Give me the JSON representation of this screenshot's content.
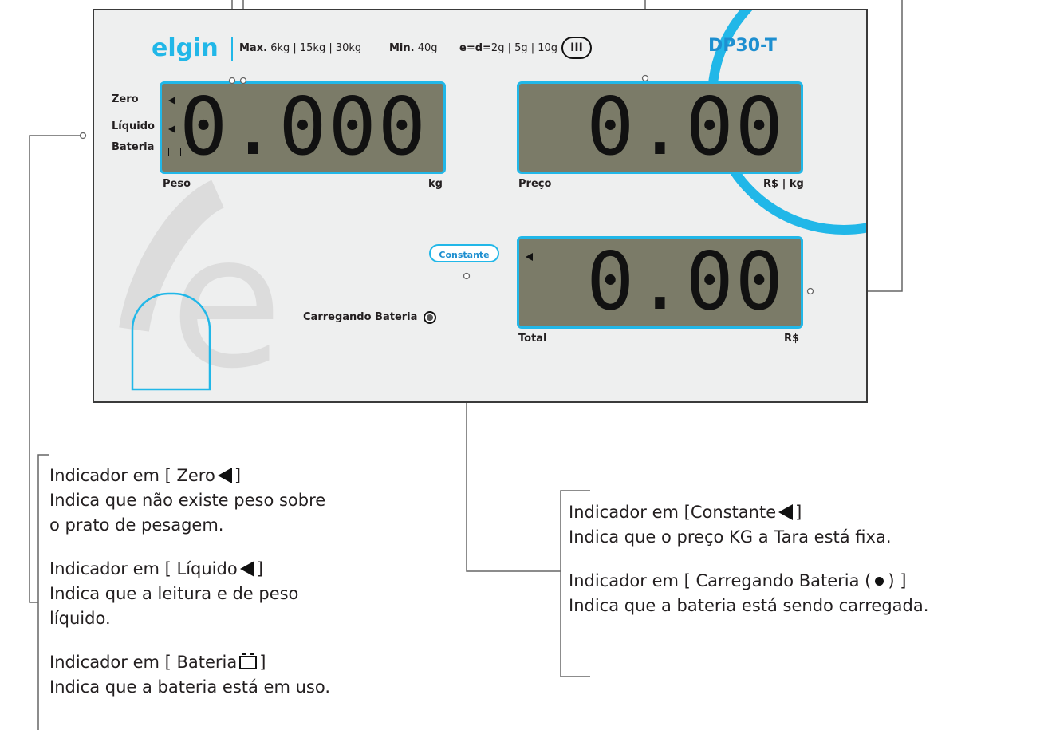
{
  "panel": {
    "brand": "elgin",
    "spec_max_label": "Max.",
    "spec_max_value": "6kg | 15kg | 30kg",
    "spec_min_label": "Min.",
    "spec_min_value": "40g",
    "spec_e_label": "e=d=",
    "spec_e_value": "2g | 5g | 10g",
    "class_badge": "III",
    "model": "DP30-T",
    "colors": {
      "accent": "#21b7e8",
      "lcd": "#7b7b68",
      "panel": "#eeefef"
    }
  },
  "indicators": {
    "zero": "Zero",
    "liquido": "Líquido",
    "bateria": "Bateria"
  },
  "displays": {
    "peso": {
      "value": "0.000",
      "label": "Peso",
      "unit": "kg"
    },
    "preco": {
      "value": "0.00",
      "label": "Preço",
      "unit": "R$ | kg"
    },
    "total": {
      "value": "0.00",
      "label": "Total",
      "unit": "R$"
    }
  },
  "constante_button": "Constante",
  "charging_label": "Carregando Bateria",
  "callouts": {
    "zero_title_a": "Indicador em [ Zero",
    "zero_title_b": "]",
    "zero_desc_1": "Indica que não existe peso sobre",
    "zero_desc_2": "o prato de pesagem.",
    "liquido_title_a": "Indicador em [ Líquido",
    "liquido_title_b": "]",
    "liquido_desc_1": "Indica que a leitura e de peso",
    "liquido_desc_2": "líquido.",
    "bateria_title_a": "Indicador em [ Bateria",
    "bateria_title_b": "]",
    "bateria_desc_1": "Indica que a bateria está em uso.",
    "constante_title_a": "Indicador em [Constante",
    "constante_title_b": "]",
    "constante_desc_1": "Indica que o preço KG a Tara está fixa.",
    "charging_title_a": "Indicador em [ Carregando Bateria (",
    "charging_title_b": ") ]",
    "charging_desc_1": "Indica que a bateria está sendo carregada."
  }
}
